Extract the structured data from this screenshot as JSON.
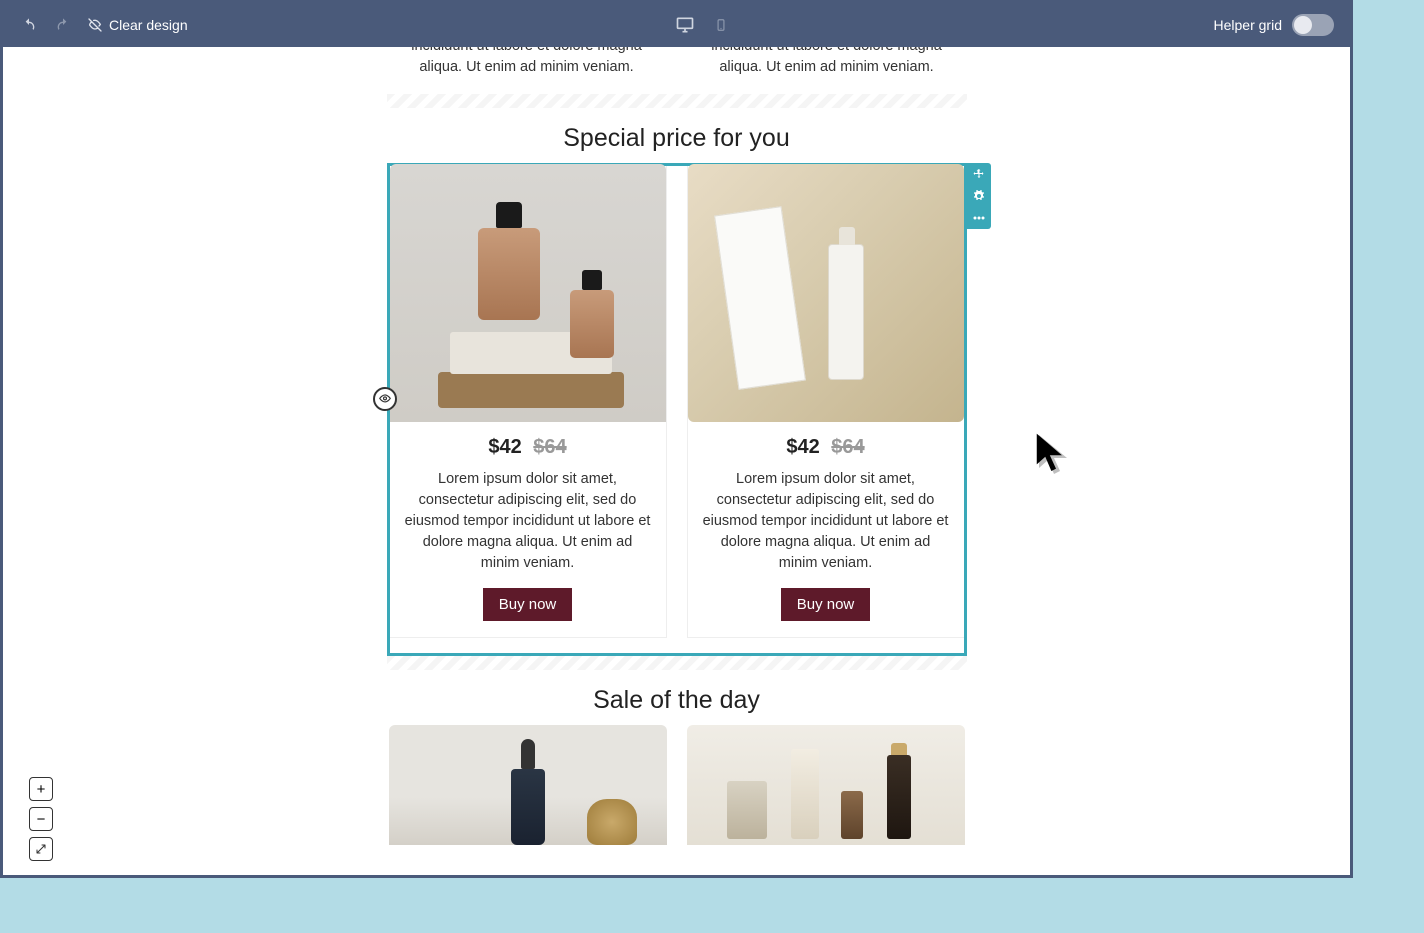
{
  "toolbar": {
    "clear_label": "Clear design",
    "helper_grid_label": "Helper grid"
  },
  "sections": {
    "top_desc": "adipiscing elit, sed do eiusmod tempor incididunt ut labore et dolore magna aliqua. Ut enim ad minim veniam.",
    "special_title": "Special price for you",
    "sale_title": "Sale of the day"
  },
  "products": {
    "special": [
      {
        "price": "$42",
        "old_price": "$64",
        "desc": "Lorem ipsum dolor sit amet, consectetur adipiscing elit, sed do eiusmod tempor incididunt ut labore et dolore magna aliqua. Ut enim ad minim veniam.",
        "cta": "Buy now"
      },
      {
        "price": "$42",
        "old_price": "$64",
        "desc": "Lorem ipsum dolor sit amet, consectetur adipiscing elit, sed do eiusmod tempor incididunt ut labore et dolore magna aliqua. Ut enim ad minim veniam.",
        "cta": "Buy now"
      }
    ]
  },
  "zoom": {
    "plus": "+",
    "minus": "−"
  }
}
